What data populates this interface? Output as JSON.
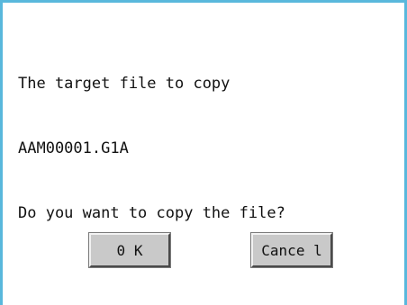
{
  "dialog": {
    "message_lines": [
      "The target file to copy",
      "AAM00001.G1A",
      "Do you want to copy the file?"
    ],
    "ok_label": "0 K",
    "cancel_label": "Cance l"
  },
  "colors": {
    "frame": "#59b8dc",
    "button_face": "#c9c9c9"
  }
}
